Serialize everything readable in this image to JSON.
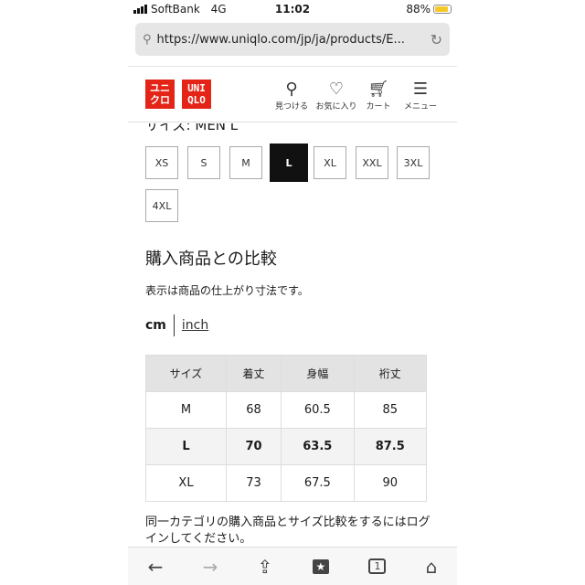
{
  "status": {
    "carrier": "SoftBank",
    "network": "4G",
    "time": "11:02",
    "battery": "88%",
    "battery_level": 0.88
  },
  "browser": {
    "url": "https://www.uniqlo.com/jp/ja/products/E..."
  },
  "header": {
    "logo_jp": [
      "ユニ",
      "クロ"
    ],
    "logo_en": [
      "UNI",
      "QLO"
    ],
    "nav": [
      {
        "icon": "search-icon",
        "label": "見つける"
      },
      {
        "icon": "heart-icon",
        "label": "お気に入り"
      },
      {
        "icon": "cart-icon",
        "label": "カート"
      },
      {
        "icon": "menu-icon",
        "label": "メニュー"
      }
    ]
  },
  "size_label": "サイズ: MEN L",
  "sizes": [
    "XS",
    "S",
    "M",
    "L",
    "XL",
    "XXL",
    "3XL",
    "4XL"
  ],
  "selected_size": "L",
  "compare": {
    "title": "購入商品との比較",
    "note": "表示は商品の仕上がり寸法です。",
    "unit_active": "cm",
    "unit_other": "inch",
    "headers": [
      "サイズ",
      "着丈",
      "身幅",
      "裄丈"
    ],
    "rows": [
      [
        "M",
        "68",
        "60.5",
        "85"
      ],
      [
        "L",
        "70",
        "63.5",
        "87.5"
      ],
      [
        "XL",
        "73",
        "67.5",
        "90"
      ]
    ],
    "login_text": "同一カテゴリの購入商品とサイズ比較をするにはログインしてください。"
  },
  "toolbar": {
    "icons": [
      "back-icon",
      "forward-icon",
      "share-icon",
      "bookmarks-icon",
      "tabs-icon",
      "home-icon"
    ],
    "tab_count": "1"
  }
}
